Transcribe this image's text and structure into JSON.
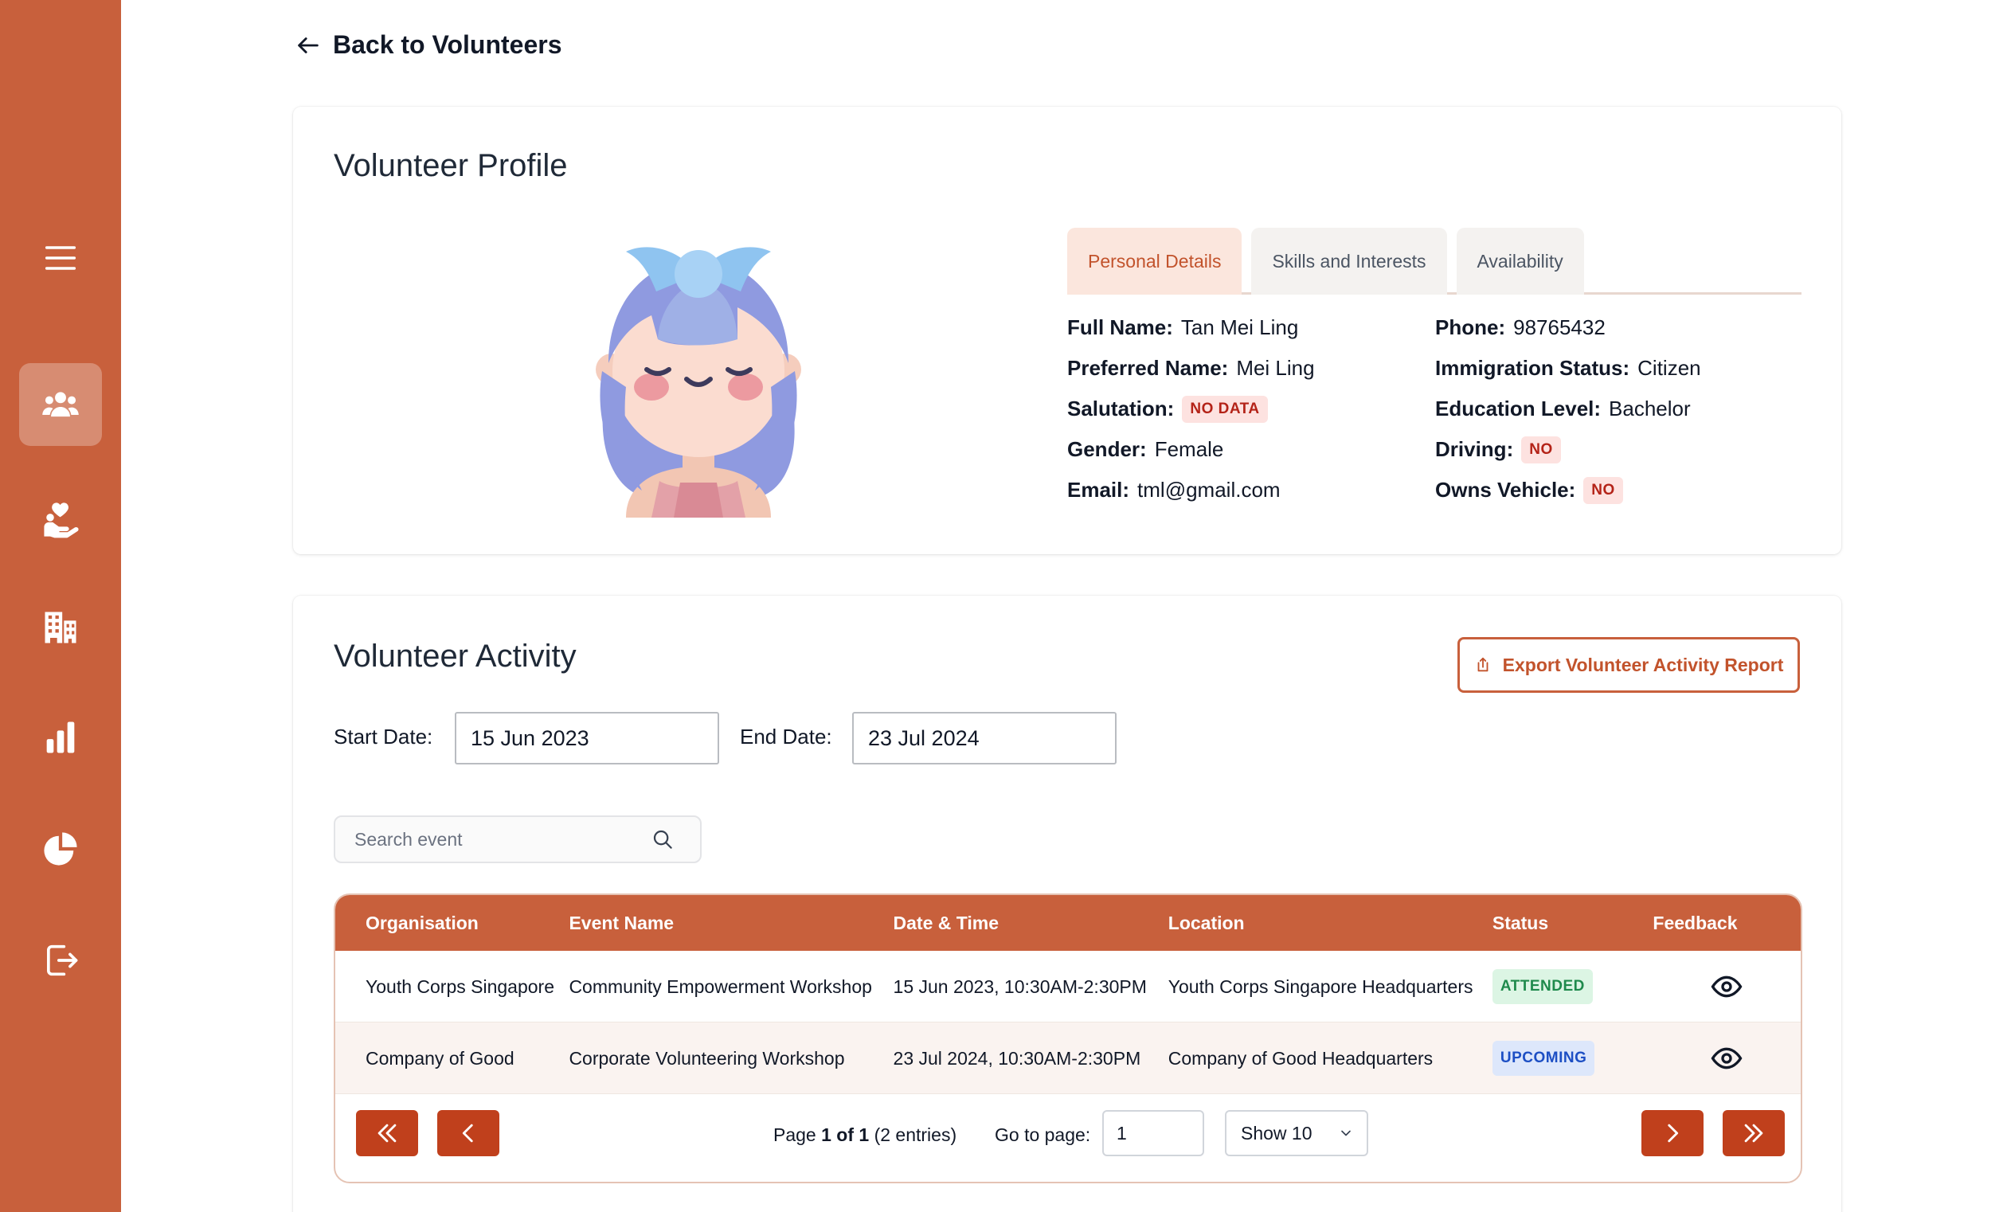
{
  "sidebar": {
    "items": [
      {
        "icon": "menu-icon",
        "active": false
      },
      {
        "icon": "users-icon",
        "active": true
      },
      {
        "icon": "volunteer-heart-hand-icon",
        "active": false
      },
      {
        "icon": "building-icon",
        "active": false
      },
      {
        "icon": "bar-chart-icon",
        "active": false
      },
      {
        "icon": "pie-chart-icon",
        "active": false
      },
      {
        "icon": "logout-icon",
        "active": false
      }
    ],
    "background": "#c8603c"
  },
  "back_link": {
    "label": "Back to Volunteers"
  },
  "profile": {
    "title": "Volunteer Profile",
    "tabs": [
      {
        "label": "Personal Details",
        "active": true
      },
      {
        "label": "Skills and Interests",
        "active": false
      },
      {
        "label": "Availability",
        "active": false
      }
    ],
    "left_details": [
      {
        "label": "Full Name:",
        "value": "Tan Mei Ling"
      },
      {
        "label": "Preferred Name:",
        "value": "Mei Ling"
      },
      {
        "label": "Salutation:",
        "badge": "NO DATA"
      },
      {
        "label": "Gender:",
        "value": "Female"
      },
      {
        "label": "Email:",
        "value": "tml@gmail.com"
      }
    ],
    "right_details": [
      {
        "label": "Phone:",
        "value": "98765432"
      },
      {
        "label": "Immigration Status:",
        "value": "Citizen"
      },
      {
        "label": "Education Level:",
        "value": "Bachelor"
      },
      {
        "label": "Driving:",
        "badge": "NO"
      },
      {
        "label": "Owns Vehicle:",
        "badge": "NO"
      }
    ]
  },
  "activity": {
    "title": "Volunteer Activity",
    "export_label": "Export Volunteer Activity Report",
    "start_date_label": "Start Date:",
    "start_date_value": "15 Jun 2023",
    "end_date_label": "End Date:",
    "end_date_value": "23 Jul 2024",
    "search_placeholder": "Search event",
    "columns": [
      "Organisation",
      "Event Name",
      "Date & Time",
      "Location",
      "Status",
      "Feedback"
    ],
    "rows": [
      {
        "organisation": "Youth Corps Singapore",
        "event": "Community Empowerment Workshop",
        "datetime": "15 Jun 2023, 10:30AM-2:30PM",
        "location": "Youth Corps Singapore Headquarters",
        "status": "ATTENDED",
        "status_color": "#1f8a4c",
        "status_bg": "#dcf5e4"
      },
      {
        "organisation": "Company of Good",
        "event": "Corporate Volunteering Workshop",
        "datetime": "23 Jul 2024, 10:30AM-2:30PM",
        "location": "Company of Good Headquarters",
        "status": "UPCOMING",
        "status_color": "#1d4fc4",
        "status_bg": "#dde7fb"
      }
    ],
    "pagination": {
      "page_prefix": "Page ",
      "page_bold": "1 of 1",
      "page_suffix": " (2 entries)",
      "goto_label": "Go to page:",
      "goto_value": "1",
      "show_label": "Show 10"
    }
  },
  "colors": {
    "accent": "#c8603c",
    "accent_dark": "#c0401c",
    "tab_active_bg": "#fbe6dd",
    "badge_red": "#b42318"
  }
}
